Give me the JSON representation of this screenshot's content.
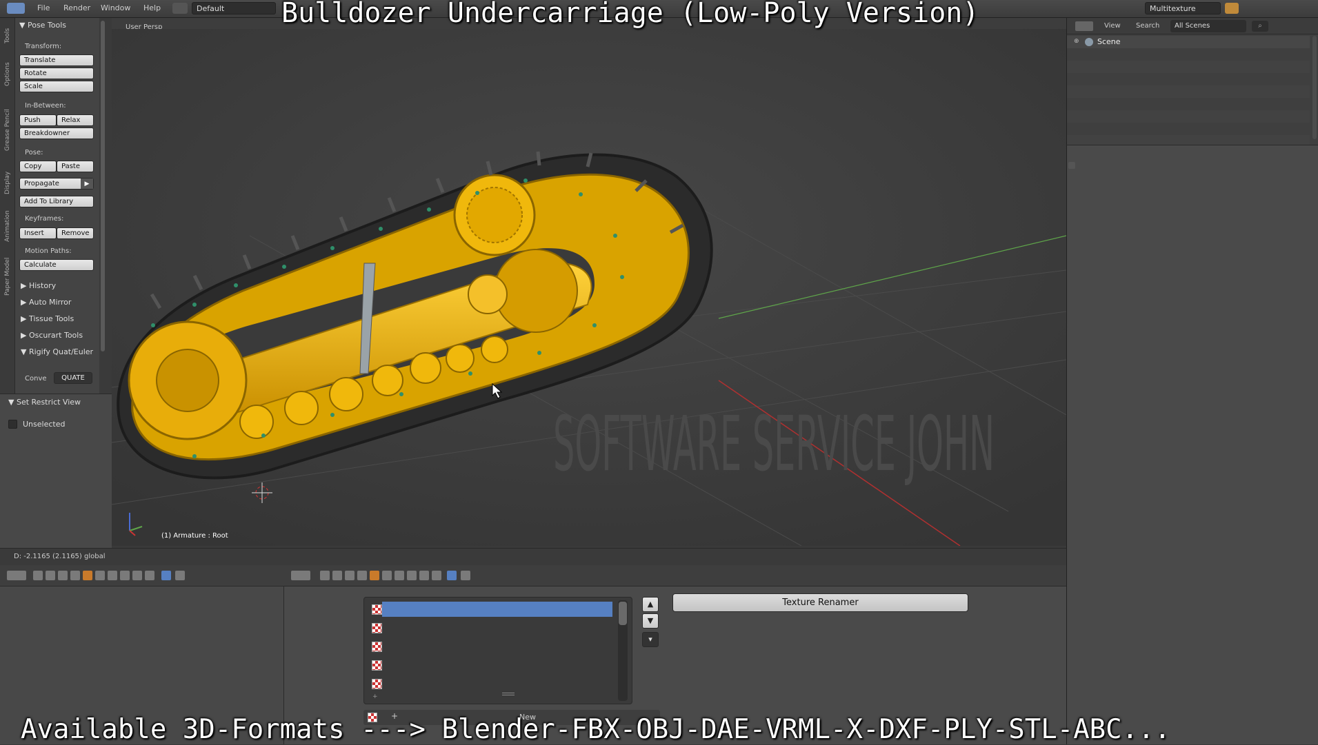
{
  "overlay": {
    "title": "Bulldozer Undercarriage (Low-Poly Version)",
    "footer": "Available 3D-Formats ---> Blender-FBX-OBJ-DAE-VRML-X-DXF-PLY-STL-ABC..."
  },
  "topbar": {
    "menus": [
      "File",
      "Render",
      "Window",
      "Help"
    ],
    "layout": "Default",
    "shading_mode": "Multitexture"
  },
  "toolshelf": {
    "tabs": [
      "Tools",
      "Options",
      "Grease Pencil",
      "Display",
      "Animation",
      "Paper Model"
    ],
    "panel_title": "Pose Tools",
    "transform_label": "Transform:",
    "translate": "Translate",
    "rotate": "Rotate",
    "scale": "Scale",
    "inbetween_label": "In-Between:",
    "push": "Push",
    "relax": "Relax",
    "breakdowner": "Breakdowner",
    "pose_label": "Pose:",
    "copy": "Copy",
    "paste": "Paste",
    "propagate": "Propagate",
    "add_to_library": "Add To Library",
    "keyframes_label": "Keyframes:",
    "insert": "Insert",
    "remove": "Remove",
    "motion_paths_label": "Motion Paths:",
    "calculate": "Calculate",
    "collapsed_panels": [
      "History",
      "Auto Mirror",
      "Tissue Tools",
      "Oscurart Tools"
    ],
    "rigify_panel": "Rigify Quat/Euler",
    "convert_label": "Conve",
    "convert_value": "QUATE"
  },
  "restrict": {
    "title": "Set Restrict View",
    "unselected": "Unselected"
  },
  "viewport": {
    "view_label": "User Persp",
    "object_label": "(1) Armature : Root",
    "watermark": "SOFTWARE SERVICE JOHN"
  },
  "status": {
    "transform_readout": "D: -2.1165 (2.1165) global"
  },
  "outliner": {
    "view": "View",
    "search": "Search",
    "scene_filter": "All Scenes",
    "scene_item": "Scene"
  },
  "texture_editor": {
    "rows": 5,
    "renamer_button": "Texture Renamer",
    "new_label": "New"
  },
  "colors": {
    "selection": "#5680c2",
    "machine_yellow": "#f2b90d",
    "axis_x": "#b03030",
    "axis_y": "#5fa64a"
  }
}
